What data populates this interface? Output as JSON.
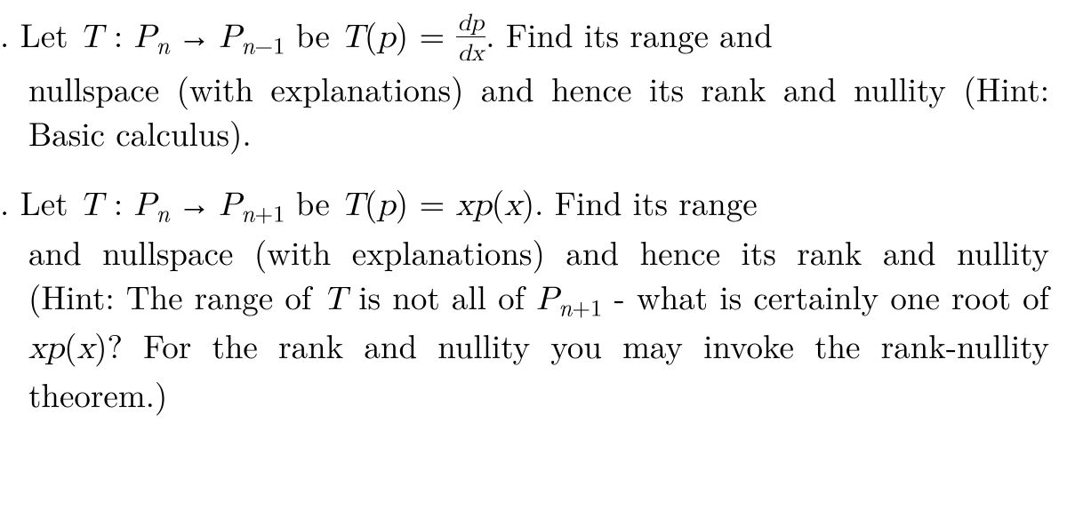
{
  "problems": [
    {
      "prefix": ". Let ",
      "map_T": "T",
      "colon": " : ",
      "dom_P": "P",
      "dom_sub": "n",
      "arrow": " → ",
      "codom_P": "P",
      "codom_sub_pre": "n",
      "codom_sub_op": "−1",
      "be": " be ",
      "Tp": "T",
      "Tp_paren_open": "(",
      "Tp_arg": "p",
      "Tp_paren_close": ")",
      "eq": " = ",
      "frac_num_d": "d",
      "frac_num_p": "p",
      "frac_den_d": "d",
      "frac_den_x": "x",
      "after_frac": ".  Find its range and",
      "rest": "nullspace (with explanations) and hence its rank and nullity (Hint: Basic calculus)."
    },
    {
      "prefix": ". Let ",
      "map_T": "T",
      "colon": " : ",
      "dom_P": "P",
      "dom_sub": "n",
      "arrow": " → ",
      "codom_P": "P",
      "codom_sub_pre": "n",
      "codom_sub_op": "+1",
      "be": " be ",
      "Tp": "T",
      "Tp_paren_open": "(",
      "Tp_arg": "p",
      "Tp_paren_close": ")",
      "eq": " = ",
      "rhs_x": "x",
      "rhs_p": "p",
      "rhs_po": "(",
      "rhs_px": "x",
      "rhs_pc": ")",
      "after_rhs": ".  Find its range",
      "rest_a": "and nullspace (with explanations) and hence its rank and nullity (Hint: The range of ",
      "rest_T": "T",
      "rest_b": " is not all of ",
      "rest_P": "P",
      "rest_P_sub_pre": "n",
      "rest_P_sub_op": "+1",
      "rest_c": " - what is certainly one root of ",
      "rest_x": "x",
      "rest_p": "p",
      "rest_po": "(",
      "rest_px": "x",
      "rest_pc": ")",
      "rest_d": "? For the rank and nullity you may invoke the rank-nullity theorem.)"
    }
  ]
}
